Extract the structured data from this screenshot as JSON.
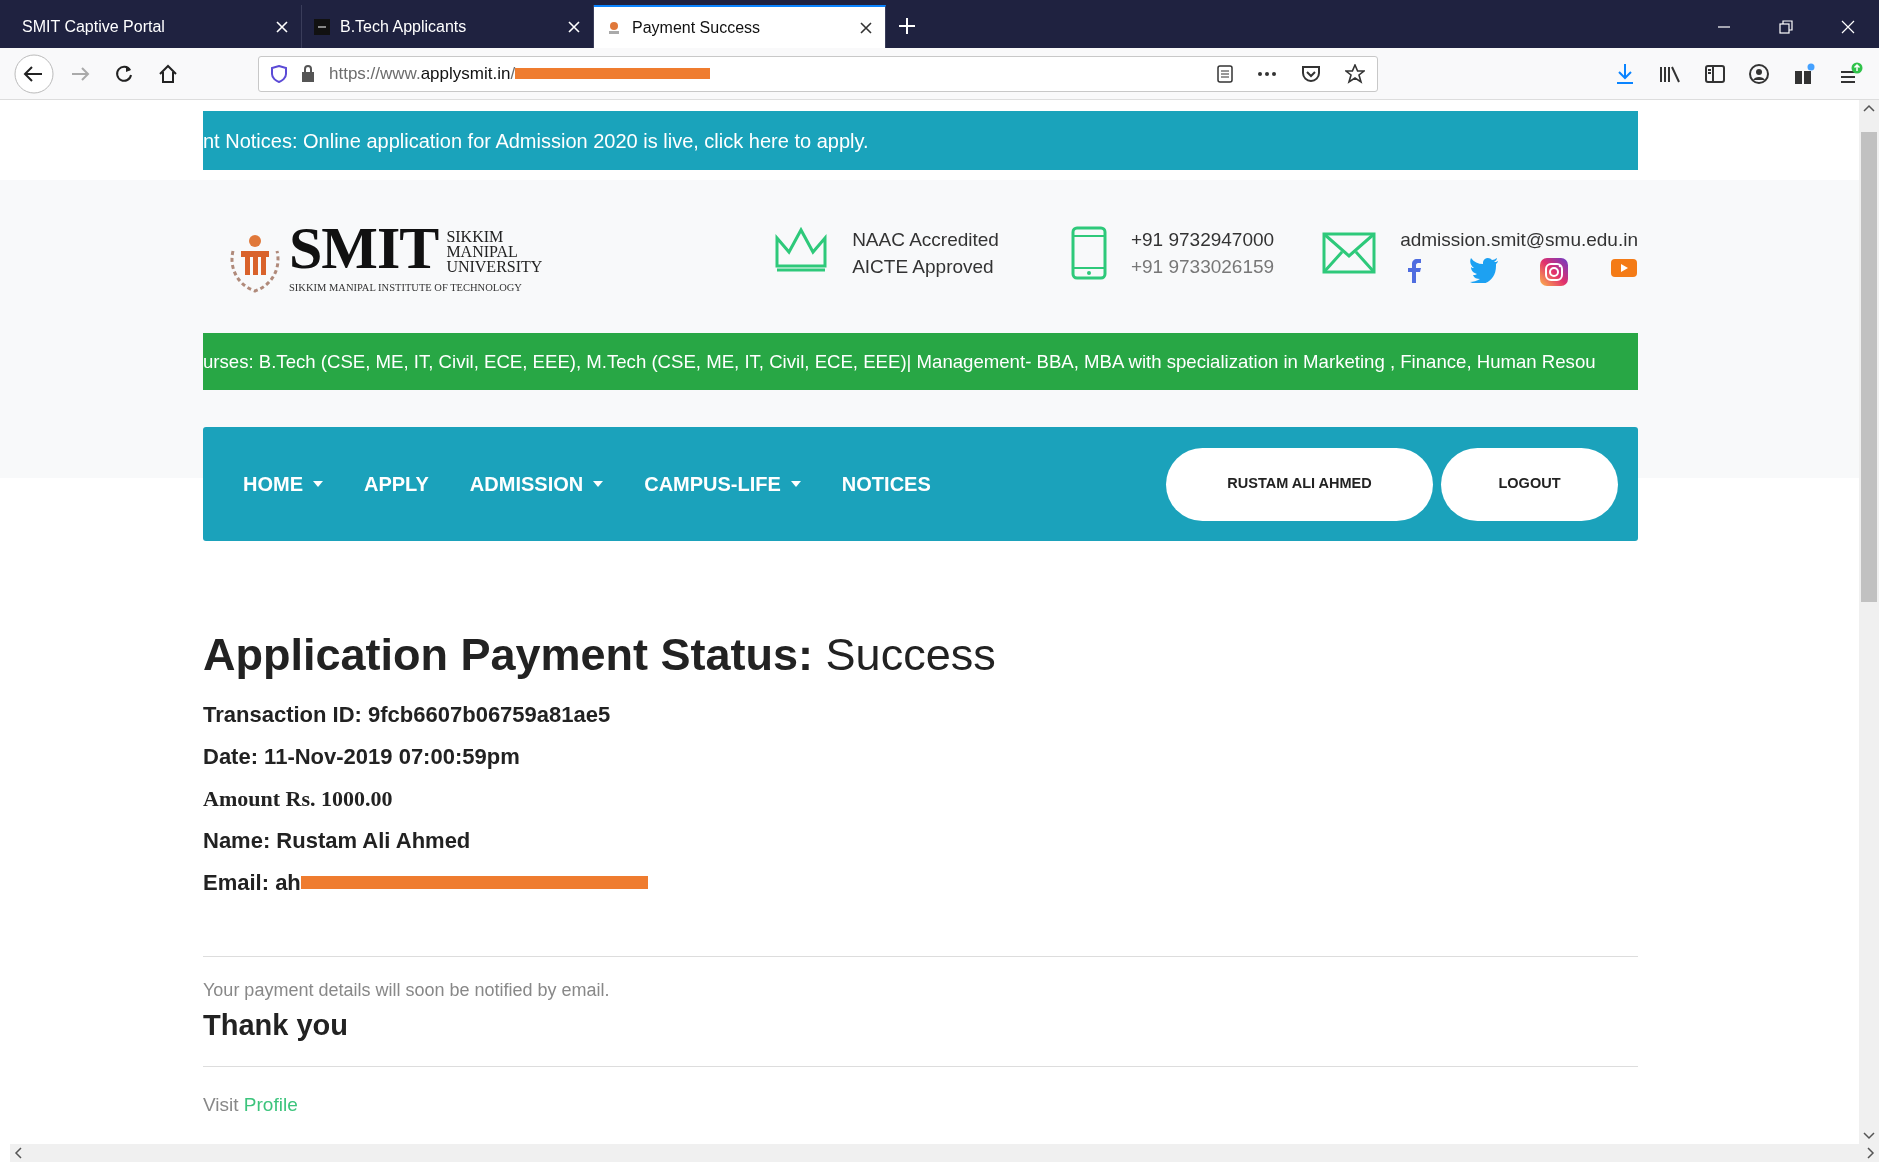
{
  "browser": {
    "tabs": [
      {
        "title": "SMIT Captive Portal",
        "selected": false,
        "kind": "plain"
      },
      {
        "title": "B.Tech Applicants",
        "selected": false,
        "kind": "dark"
      },
      {
        "title": "Payment Success",
        "selected": true,
        "kind": "logo"
      }
    ],
    "url": {
      "host_part": "https://www.",
      "domain": "applysmit.in",
      "path": "/"
    }
  },
  "notice_bar": {
    "text": "nt Notices: Online application for Admission 2020 is live, click here to apply."
  },
  "header": {
    "logo": {
      "wordmark": "SMIT",
      "university_lines": [
        "SIKKIM",
        "MANIPAL",
        "UNIVERSITY"
      ],
      "institute": "SIKKIM MANIPAL INSTITUTE OF TECHNOLOGY"
    },
    "accreditation": [
      "NAAC Accredited",
      "AICTE Approved"
    ],
    "phones": [
      "+91 9732947000",
      "+91 9733026159"
    ],
    "email": "admission.smit@smu.edu.in"
  },
  "courses_ticker": {
    "text": "urses: B.Tech (CSE, ME, IT, Civil, ECE, EEE), M.Tech (CSE, ME, IT, Civil, ECE, EEE)| Management- BBA, MBA with specialization in Marketing , Finance, Human Resou"
  },
  "nav": {
    "items": [
      {
        "label": "HOME",
        "dropdown": true
      },
      {
        "label": "APPLY",
        "dropdown": false
      },
      {
        "label": "ADMISSION",
        "dropdown": true
      },
      {
        "label": "CAMPUS-LIFE",
        "dropdown": true
      },
      {
        "label": "NOTICES",
        "dropdown": false
      }
    ],
    "user_button": "RUSTAM ALI AHMED",
    "logout_button": "LOGOUT"
  },
  "status": {
    "title": "**Application Payment Status:** Success",
    "fields": [
      {
        "text": "Transaction ID: 9fcb6607b06759a81ae5",
        "kind": "plain"
      },
      {
        "text": "Date: 11-Nov-2019 07:00:59pm",
        "kind": "plain"
      },
      {
        "text": "Amount Rs. 1000.00",
        "kind": "serif"
      },
      {
        "text": "Name: Rustam Ali Ahmed",
        "kind": "plain"
      },
      {
        "text": "Email: ah",
        "kind": "redacted"
      }
    ],
    "notification": "Your payment details will soon be notified by email.",
    "thanks": "Thank you",
    "visit": "Visit",
    "profile_link": "Profile"
  }
}
